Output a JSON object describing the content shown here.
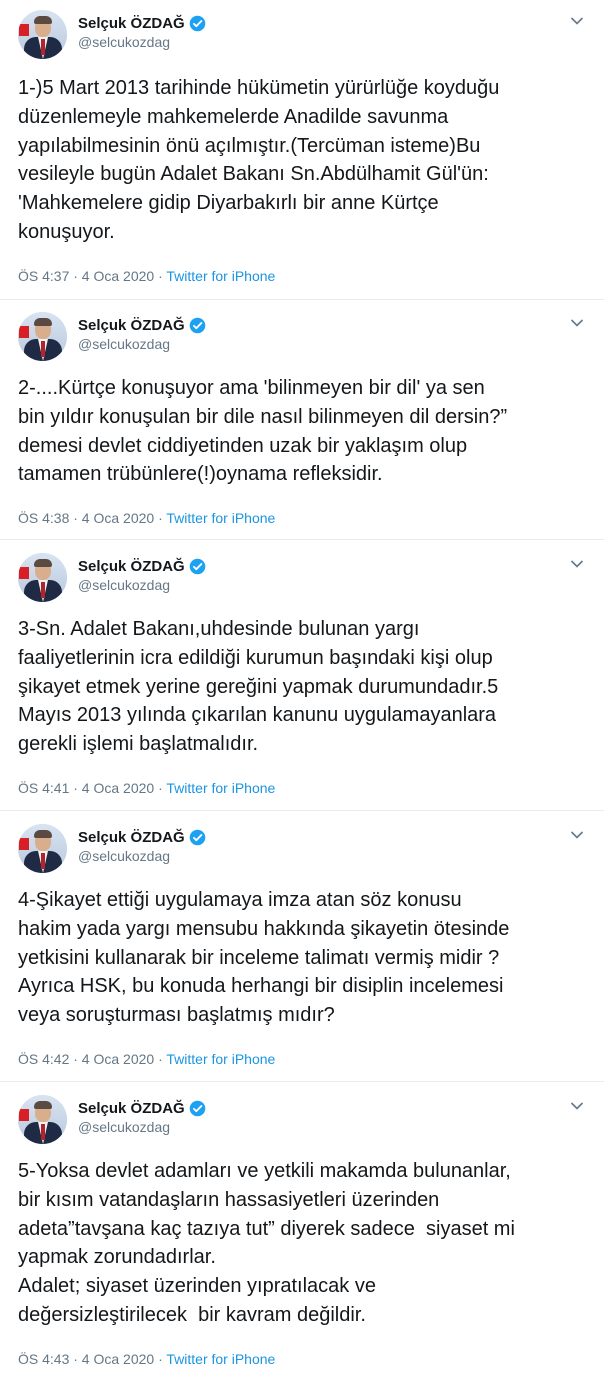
{
  "author": {
    "name": "Selçuk ÖZDAĞ",
    "handle": "@selcukozdag"
  },
  "colors": {
    "link": "#1b95e0",
    "verified": "#1da1f2",
    "secondary_text": "#657786"
  },
  "tweets": [
    {
      "text": "1-)5 Mart 2013 tarihinde hükümetin yürürlüğe koyduğu\ndüzenlemeyle mahkemelerde Anadilde savunma\nyapılabilmesinin önü açılmıştır.(Tercüman isteme)Bu\nvesileyle bugün Adalet Bakanı Sn.Abdülhamit Gül'ün:\n'Mahkemelere gidip Diyarbakırlı bir anne Kürtçe\nkonuşuyor.",
      "time": "ÖS 4:37 · 4 Oca 2020 · ",
      "source": "Twitter for iPhone"
    },
    {
      "text": "2-....Kürtçe konuşuyor ama 'bilinmeyen bir dil' ya sen\nbin yıldır konuşulan bir dile nasıl bilinmeyen dil dersin?”\ndemesi devlet ciddiyetinden uzak bir yaklaşım olup\ntamamen trübünlere(!)oynama refleksidir.",
      "time": "ÖS 4:38 · 4 Oca 2020 · ",
      "source": "Twitter for iPhone"
    },
    {
      "text": "3-Sn. Adalet Bakanı,uhdesinde bulunan yargı\nfaaliyetlerinin icra edildiği kurumun başındaki kişi olup\nşikayet etmek yerine gereğini yapmak durumundadır.5\nMayıs 2013 yılında çıkarılan kanunu uygulamayanlara\ngerekli işlemi başlatmalıdır.",
      "time": "ÖS 4:41 · 4 Oca 2020 · ",
      "source": "Twitter for iPhone"
    },
    {
      "text": "4-Şikayet ettiği uygulamaya imza atan söz konusu\nhakim yada yargı mensubu hakkında şikayetin ötesinde\nyetkisini kullanarak bir inceleme talimatı vermiş midir ?\nAyrıca HSK, bu konuda herhangi bir disiplin incelemesi\nveya soruşturması başlatmış mıdır?",
      "time": "ÖS 4:42 · 4 Oca 2020 · ",
      "source": "Twitter for iPhone"
    },
    {
      "text": "5-Yoksa devlet adamları ve yetkili makamda bulunanlar,\nbir kısım vatandaşların hassasiyetleri üzerinden\nadeta”tavşana kaç tazıya tut” diyerek sadece  siyaset mi\nyapmak zorundadırlar.\nAdalet; siyaset üzerinden yıpratılacak ve\ndeğersizleştirilecek  bir kavram değildir.",
      "time": "ÖS 4:43 · 4 Oca 2020 · ",
      "source": "Twitter for iPhone"
    }
  ]
}
